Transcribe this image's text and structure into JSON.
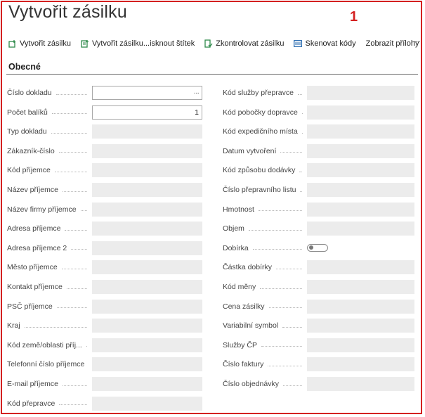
{
  "page": {
    "title": "Vytvořit zásilku",
    "marker": "1"
  },
  "colors": {
    "frame_border": "#d42020",
    "readonly_field": "#ececec",
    "icon_green": "#2e8a4a",
    "icon_blue": "#2b6cb0"
  },
  "actions": [
    {
      "label": "Vytvořit zásilku",
      "icon": "create-shipment-icon"
    },
    {
      "label": "Vytvořit zásilku...isknout štítek",
      "icon": "create-print-label-icon"
    },
    {
      "label": "Zkontrolovat zásilku",
      "icon": "check-shipment-icon"
    },
    {
      "label": "Skenovat kódy",
      "icon": "scan-codes-icon"
    },
    {
      "label": "Zobrazit přílohy",
      "icon": ""
    }
  ],
  "more_actions": "···",
  "section": {
    "title": "Obecné"
  },
  "left_fields": [
    {
      "label": "Číslo dokladu",
      "value": "",
      "editable": true,
      "assist": "···"
    },
    {
      "label": "Počet balíků",
      "value": "1",
      "editable": true
    },
    {
      "label": "Typ dokladu",
      "value": ""
    },
    {
      "label": "Zákazník-číslo",
      "value": ""
    },
    {
      "label": "Kód příjemce",
      "value": ""
    },
    {
      "label": "Název příjemce",
      "value": ""
    },
    {
      "label": "Název firmy příjemce",
      "value": ""
    },
    {
      "label": "Adresa příjemce",
      "value": ""
    },
    {
      "label": "Adresa příjemce 2",
      "value": ""
    },
    {
      "label": "Město příjemce",
      "value": ""
    },
    {
      "label": "Kontakt příjemce",
      "value": ""
    },
    {
      "label": "PSČ příjemce",
      "value": ""
    },
    {
      "label": "Kraj",
      "value": ""
    },
    {
      "label": "Kód země/oblasti příj...",
      "value": ""
    },
    {
      "label": "Telefonní číslo příjemce",
      "value": ""
    },
    {
      "label": "E-mail příjemce",
      "value": ""
    },
    {
      "label": "Kód přepravce",
      "value": ""
    }
  ],
  "right_fields": [
    {
      "label": "Kód služby přepravce",
      "value": ""
    },
    {
      "label": "Kód pobočky dopravce",
      "value": ""
    },
    {
      "label": "Kód expedičního místa",
      "value": ""
    },
    {
      "label": "Datum vytvoření",
      "value": ""
    },
    {
      "label": "Kód způsobu dodávky",
      "value": ""
    },
    {
      "label": "Číslo přepravního listu",
      "value": ""
    },
    {
      "label": "Hmotnost",
      "value": ""
    },
    {
      "label": "Objem",
      "value": ""
    },
    {
      "label": "Dobírka",
      "toggle": true,
      "checked": false
    },
    {
      "label": "Částka dobírky",
      "value": ""
    },
    {
      "label": "Kód měny",
      "value": ""
    },
    {
      "label": "Cena zásilky",
      "value": ""
    },
    {
      "label": "Variabilní symbol",
      "value": ""
    },
    {
      "label": "Služby ČP",
      "value": ""
    },
    {
      "label": "Číslo faktury",
      "value": ""
    },
    {
      "label": "Číslo objednávky",
      "value": ""
    }
  ]
}
